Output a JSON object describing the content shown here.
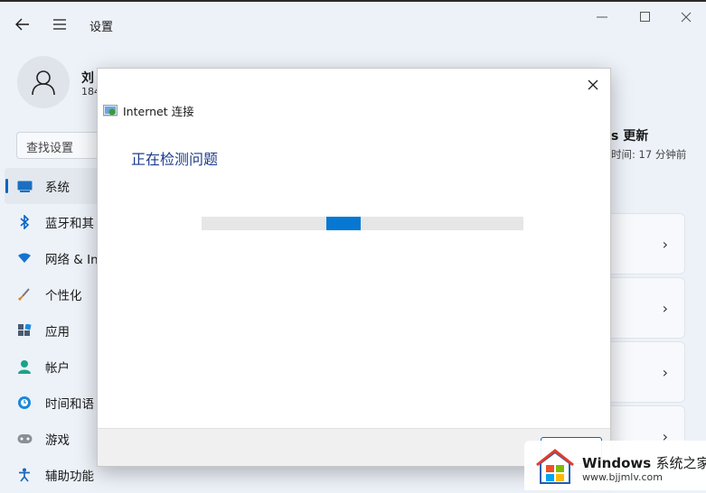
{
  "window": {
    "title": "设置",
    "back_icon": "back-arrow-icon",
    "menu_icon": "hamburger-icon",
    "controls": [
      "minimize-icon",
      "maximize-icon",
      "close-icon"
    ]
  },
  "user": {
    "name": "刘",
    "subtitle": "184"
  },
  "search": {
    "placeholder": "查找设置"
  },
  "sidebar": {
    "items": [
      {
        "label": "系统",
        "icon": "system-display-icon",
        "active": true
      },
      {
        "label": "蓝牙和其",
        "icon": "bluetooth-icon"
      },
      {
        "label": "网络 & In",
        "icon": "wifi-icon"
      },
      {
        "label": "个性化",
        "icon": "brush-icon"
      },
      {
        "label": "应用",
        "icon": "apps-icon"
      },
      {
        "label": "帐户",
        "icon": "account-icon"
      },
      {
        "label": "时间和语",
        "icon": "time-language-icon"
      },
      {
        "label": "游戏",
        "icon": "gamepad-icon"
      },
      {
        "label": "辅助功能",
        "icon": "accessibility-icon"
      }
    ]
  },
  "right_panel": {
    "title": "s 更新",
    "subtitle": "时间: 17 分钟前"
  },
  "dialog": {
    "app_title": "Internet 连接",
    "heading": "正在检测问题",
    "progress_indicator": "indeterminate",
    "accent_color": "#0678d4"
  },
  "watermark": {
    "brand": "Windows",
    "brand_cn": "系统之家",
    "url": "www.bjjmlv.com"
  }
}
